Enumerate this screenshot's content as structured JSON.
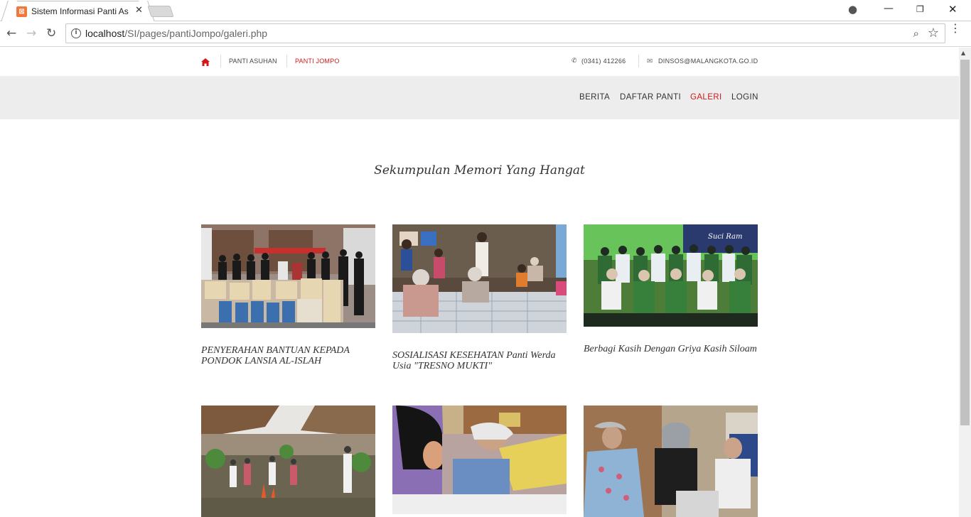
{
  "browser": {
    "tab_title": "Sistem Informasi Panti As",
    "url_host": "localhost",
    "url_path": "/SI/pages/pantiJompo/galeri.php"
  },
  "topbar": {
    "links": [
      "PANTI ASUHAN",
      "PANTI JOMPO"
    ],
    "phone": "(0341) 412266",
    "email": "DINSOS@MALANGKOTA.GO.ID"
  },
  "nav": {
    "items": [
      "BERITA",
      "DAFTAR PANTI",
      "GALERI",
      "LOGIN"
    ],
    "active": "GALERI"
  },
  "gallery": {
    "heading": "Sekumpulan Memori Yang Hangat",
    "items": [
      {
        "caption": "PENYERAHAN BANTUAN KEPADA PONDOK LANSIA AL-ISLAH"
      },
      {
        "caption": "SOSIALISASI KESEHATAN Panti Werda Usia \"TRESNO MUKTI\""
      },
      {
        "caption": "Berbagi Kasih Dengan Griya Kasih Siloam"
      },
      {
        "caption": ""
      },
      {
        "caption": ""
      },
      {
        "caption": ""
      }
    ]
  },
  "colors": {
    "accent": "#d0191b",
    "nav_bg": "#ededed"
  }
}
